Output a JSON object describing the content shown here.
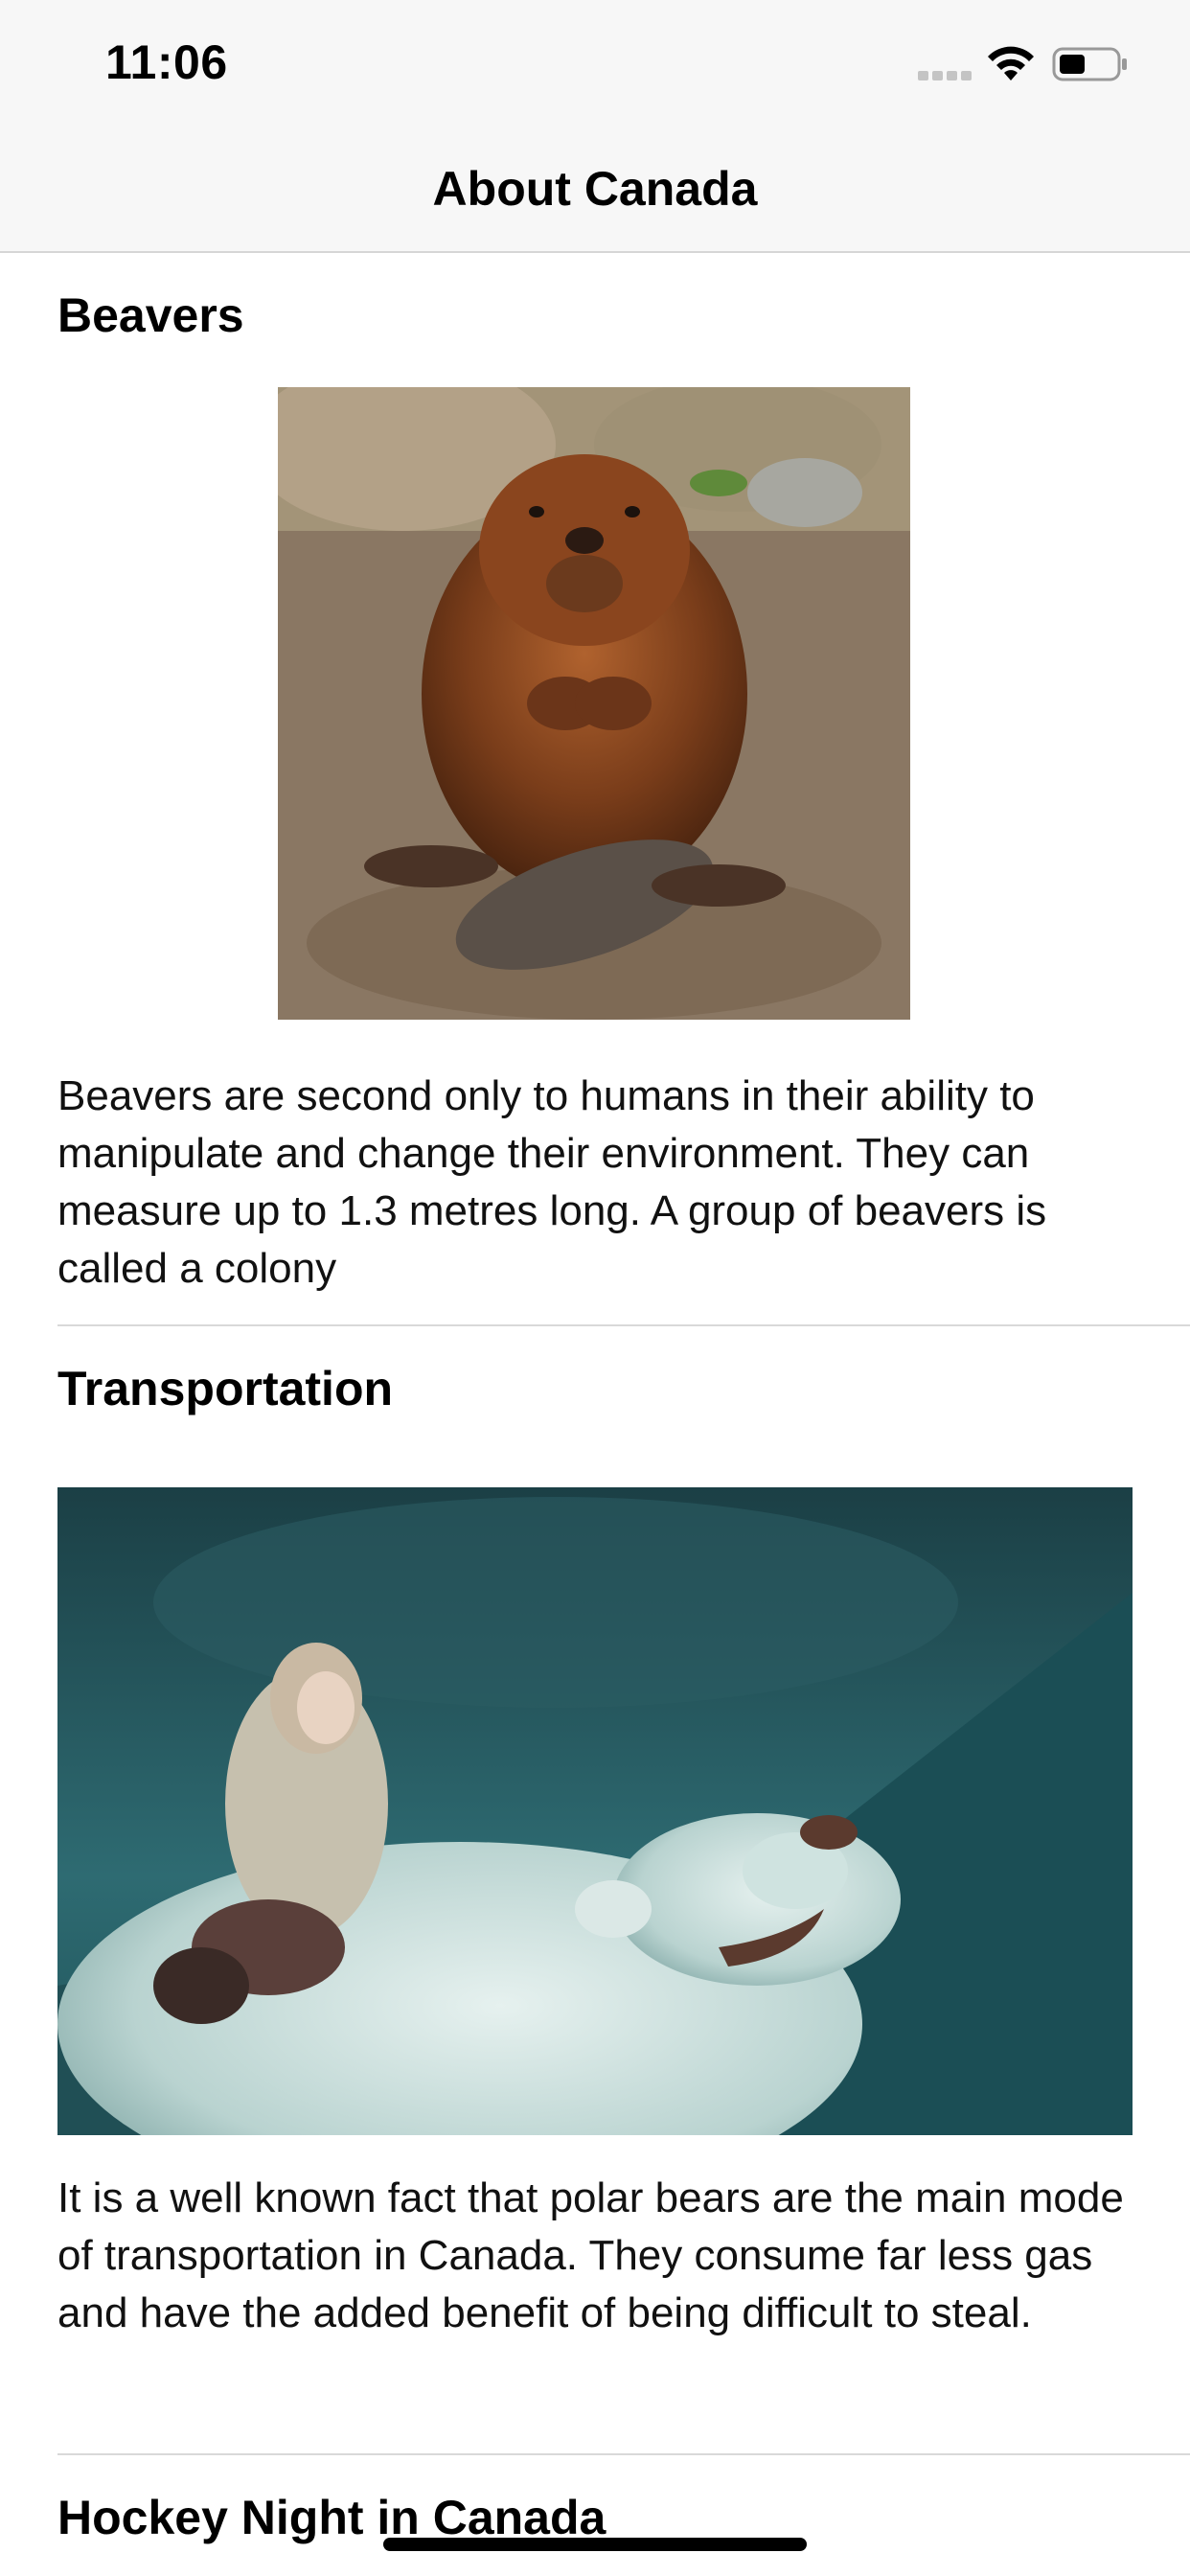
{
  "status_bar": {
    "time": "11:06",
    "icons": [
      "signal-icon",
      "wifi-icon",
      "battery-icon"
    ]
  },
  "nav": {
    "title": "About Canada"
  },
  "rows": [
    {
      "title": "Beavers",
      "description": "Beavers are second only to humans in their ability to manipulate and change their environment. They can measure up to 1.3 metres long. A group of beavers is called a colony"
    },
    {
      "title": "Transportation",
      "description": "It is a well known fact that polar bears are the main mode of transportation in Canada. They consume far less gas and have the added benefit of being difficult to steal."
    },
    {
      "title": "Hockey Night in Canada"
    }
  ],
  "colors": {
    "nav_background": "#f7f7f7",
    "separator": "#d9d9d9",
    "text": "#000000"
  }
}
